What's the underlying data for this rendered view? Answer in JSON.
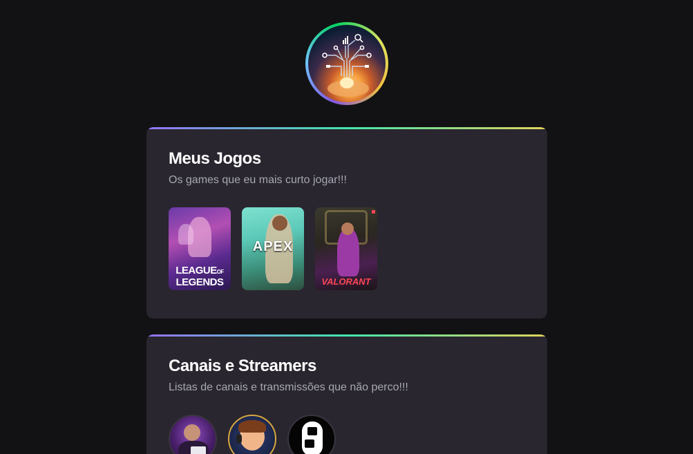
{
  "profile": {
    "avatar_icon": "circuit-hand-icon"
  },
  "games_section": {
    "title": "Meus Jogos",
    "subtitle": "Os games que eu mais curto jogar!!!",
    "games": [
      {
        "name": "League of Legends",
        "logo_line1": "LEAGUE",
        "logo_of": "OF",
        "logo_line2": "LEGENDS"
      },
      {
        "name": "Apex Legends",
        "logo": "APEX"
      },
      {
        "name": "Valorant",
        "logo": "VALORANT"
      }
    ]
  },
  "streamers_section": {
    "title": "Canais e Streamers",
    "subtitle": "Listas de canais e transmissões que não perco!!!"
  },
  "colors": {
    "background": "#121214",
    "card": "#29262f",
    "title": "#ffffff",
    "subtitle": "#a8a8b3",
    "gradient": [
      "#9572fc",
      "#43e7ad",
      "#e2d45c"
    ]
  }
}
